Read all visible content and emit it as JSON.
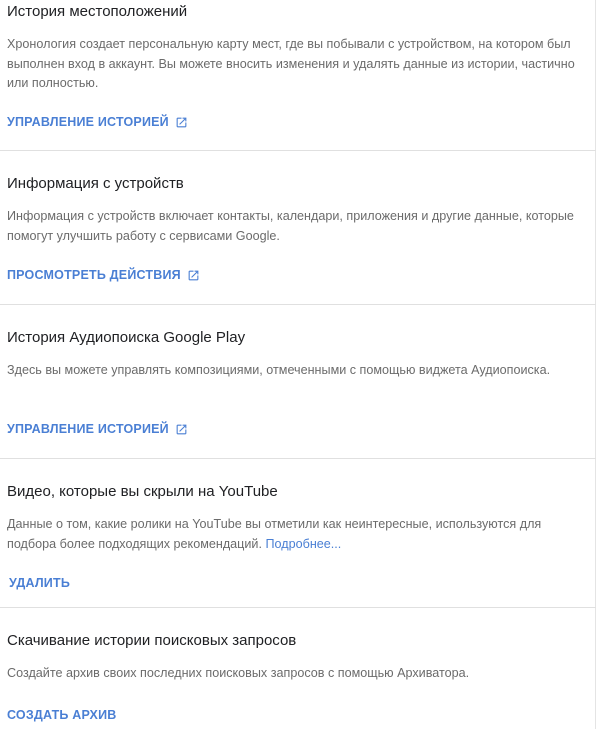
{
  "sections": [
    {
      "title": "История местоположений",
      "description": "Хронология создает персональную карту мест, где вы побывали с устройством, на котором был выполнен вход в аккаунт. Вы можете вносить изменения и удалять данные из истории, частично или полностью.",
      "action": "УПРАВЛЕНИЕ ИСТОРИЕЙ",
      "action_icon": "open-in-new-icon"
    },
    {
      "title": "Информация с устройств",
      "description": "Информация с устройств включает контакты, календари, приложения и другие данные, которые помогут улучшить работу с сервисами Google.",
      "action": "ПРОСМОТРЕТЬ ДЕЙСТВИЯ",
      "action_icon": "open-in-new-icon"
    },
    {
      "title": "История Аудиопоиска Google Play",
      "description": "Здесь вы можете управлять композициями, отмеченными с помощью виджета Аудиопоиска.",
      "action": "УПРАВЛЕНИЕ ИСТОРИЕЙ",
      "action_icon": "open-in-new-icon"
    },
    {
      "title": "Видео, которые вы скрыли на YouTube",
      "description": "Данные о том, какие ролики на YouTube вы отметили как неинтересные, используются для подбора более подходящих рекомендаций.",
      "description_link": "Подробнее...",
      "action": "УДАЛИТЬ"
    },
    {
      "title": "Скачивание истории поисковых запросов",
      "description": "Создайте архив своих последних поисковых запросов с помощью Архиватора.",
      "action": "СОЗДАТЬ АРХИВ"
    }
  ],
  "colors": {
    "link": "#4a7fd4",
    "title": "#202124",
    "description": "#6b6b6b",
    "divider": "#e0e0e0"
  }
}
